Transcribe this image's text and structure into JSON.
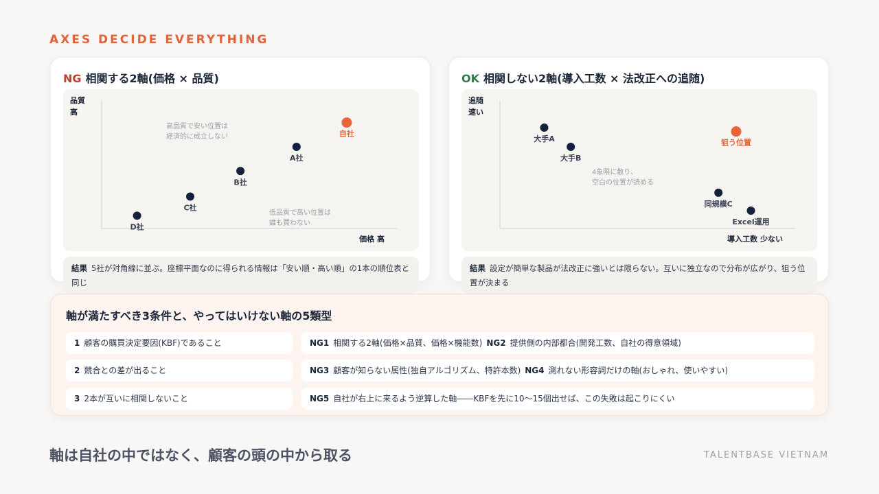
{
  "kicker": "AXES DECIDE EVERYTHING",
  "left_card": {
    "tag": "NG",
    "title": "相関する2軸(価格 × 品質)",
    "y_axis": [
      "品質",
      "高"
    ],
    "x_axis": "価格 高",
    "points": [
      {
        "label": "D社",
        "x": 0.12,
        "y": 0.1,
        "highlight": false
      },
      {
        "label": "C社",
        "x": 0.3,
        "y": 0.25,
        "highlight": false
      },
      {
        "label": "B社",
        "x": 0.47,
        "y": 0.45,
        "highlight": false
      },
      {
        "label": "A社",
        "x": 0.66,
        "y": 0.64,
        "highlight": false
      },
      {
        "label": "自社",
        "x": 0.83,
        "y": 0.83,
        "highlight": true
      }
    ],
    "notes": [
      {
        "lines": [
          "高品質で安い位置は",
          "経済的に成立しない"
        ],
        "pos": "top-left"
      },
      {
        "lines": [
          "低品質で高い位置は",
          "誰も買わない"
        ],
        "pos": "bottom-right"
      }
    ],
    "result_label": "結果",
    "result_text": "5社が対角線に並ぶ。座標平面なのに得られる情報は「安い順・高い順」の1本の順位表と同じ"
  },
  "right_card": {
    "tag": "OK",
    "title": "相関しない2軸(導入工数 × 法改正への追随)",
    "y_axis": [
      "追随",
      "速い"
    ],
    "x_axis": "導入工数 少ない",
    "points": [
      {
        "label": "大手A",
        "x": 0.15,
        "y": 0.79,
        "highlight": false
      },
      {
        "label": "大手B",
        "x": 0.24,
        "y": 0.64,
        "highlight": false
      },
      {
        "label": "狙う位置",
        "x": 0.8,
        "y": 0.76,
        "highlight": true
      },
      {
        "label": "同規模C",
        "x": 0.74,
        "y": 0.28,
        "highlight": false
      },
      {
        "label": "Excel運用",
        "x": 0.85,
        "y": 0.14,
        "highlight": false
      }
    ],
    "notes": [
      {
        "lines": [
          "4象限に散り、",
          "空白の位置が読める"
        ],
        "pos": "center"
      }
    ],
    "result_label": "結果",
    "result_text": "設定が簡単な製品が法改正に強いとは限らない。互いに独立なので分布が広がり、狙う位置が決まる"
  },
  "bottom": {
    "title": "軸が満たすべき3条件と、やってはいけない軸の5類型",
    "conditions": [
      {
        "num": "1",
        "text": "顧客の購買決定要因(KBF)であること"
      },
      {
        "num": "2",
        "text": "競合との差が出ること"
      },
      {
        "num": "3",
        "text": "2本が互いに相関しないこと"
      }
    ],
    "ng_rows": [
      {
        "a_num": "NG1",
        "a_text": "相関する2軸(価格×品質、価格×機能数)",
        "b_num": "NG2",
        "b_text": "提供側の内部都合(開発工数、自社の得意領域)"
      },
      {
        "a_num": "NG3",
        "a_text": "顧客が知らない属性(独自アルゴリズム、特許本数)",
        "b_num": "NG4",
        "b_text": "測れない形容詞だけの軸(おしゃれ、使いやすい)"
      },
      {
        "a_num": "NG5",
        "a_text": "自社が右上に来るよう逆算した軸――KBFを先に10〜15個出せば、この失敗は起こりにくい",
        "b_num": "",
        "b_text": ""
      }
    ]
  },
  "takeaway": "軸は自社の中ではなく、顧客の頭の中から取る",
  "brand": "TALENTBASE VIETNAM",
  "colors": {
    "accent": "#e8643a",
    "dot": "#14213a",
    "ng": "#c2412d",
    "ok": "#2e7d4a"
  }
}
